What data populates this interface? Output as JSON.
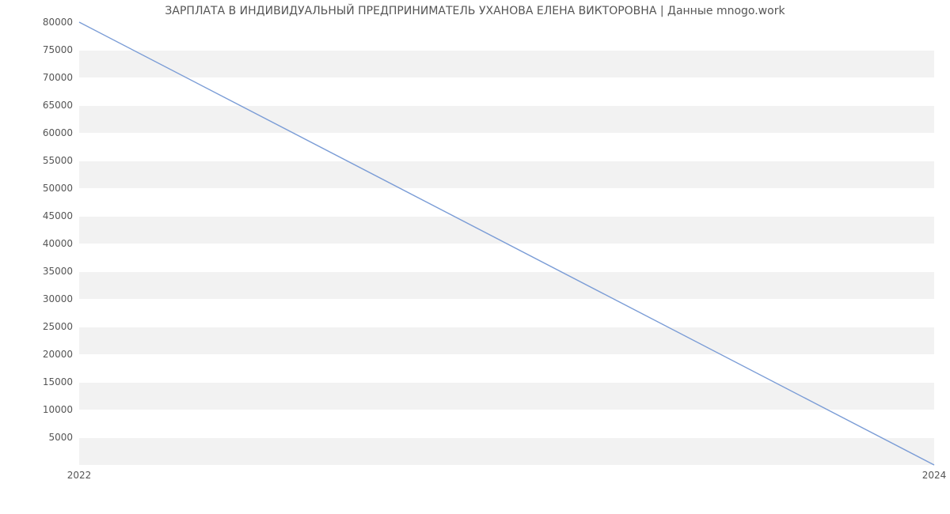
{
  "chart_data": {
    "type": "line",
    "title": "ЗАРПЛАТА В ИНДИВИДУАЛЬНЫЙ ПРЕДПРИНИМАТЕЛЬ УХАНОВА ЕЛЕНА ВИКТОРОВНА | Данные mnogo.work",
    "xlabel": "",
    "ylabel": "",
    "x": [
      2022,
      2024
    ],
    "values": [
      80000,
      0
    ],
    "x_ticks": [
      2022,
      2024
    ],
    "y_ticks": [
      5000,
      10000,
      15000,
      20000,
      25000,
      30000,
      35000,
      40000,
      45000,
      50000,
      55000,
      60000,
      65000,
      70000,
      75000,
      80000
    ],
    "xlim": [
      2022,
      2024
    ],
    "ylim": [
      0,
      80000
    ],
    "grid": true,
    "line_color": "#7a9cd6"
  }
}
